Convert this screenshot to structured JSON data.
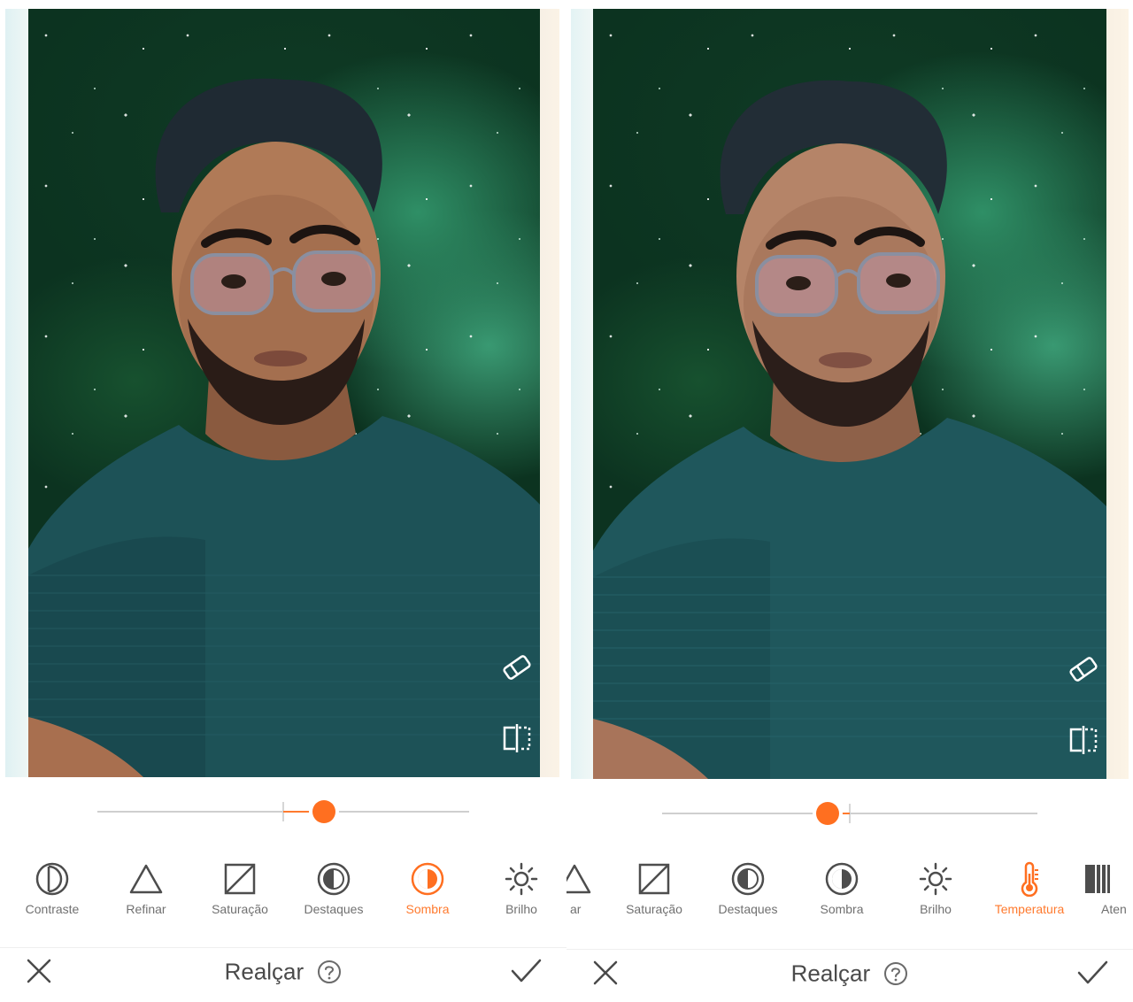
{
  "panels": [
    {
      "id": "left",
      "tools": [
        {
          "name": "contraste",
          "label": "Contraste",
          "icon": "contrast-icon",
          "active": false
        },
        {
          "name": "refinar",
          "label": "Refinar",
          "icon": "triangle-icon",
          "active": false
        },
        {
          "name": "saturacao",
          "label": "Saturação",
          "icon": "saturation-icon",
          "active": false
        },
        {
          "name": "destaques",
          "label": "Destaques",
          "icon": "highlights-icon",
          "active": false
        },
        {
          "name": "sombra",
          "label": "Sombra",
          "icon": "shadow-icon",
          "active": true
        },
        {
          "name": "brilho",
          "label": "Brilho",
          "icon": "brightness-icon",
          "active": false
        }
      ],
      "slider": {
        "min": -100,
        "max": 100,
        "value": 22
      },
      "bottom": {
        "title": "Realçar"
      }
    },
    {
      "id": "right",
      "tools": [
        {
          "name": "refinar-partial",
          "label": "ar",
          "icon": "triangle-icon",
          "active": false
        },
        {
          "name": "saturacao",
          "label": "Saturação",
          "icon": "saturation-icon",
          "active": false
        },
        {
          "name": "destaques",
          "label": "Destaques",
          "icon": "highlights-icon",
          "active": false
        },
        {
          "name": "sombra",
          "label": "Sombra",
          "icon": "shadow-icon",
          "active": false
        },
        {
          "name": "brilho",
          "label": "Brilho",
          "icon": "brightness-icon",
          "active": false
        },
        {
          "name": "temperatura",
          "label": "Temperatura",
          "icon": "thermometer-icon",
          "active": true
        },
        {
          "name": "atenuar-partial",
          "label": "Aten",
          "icon": "fade-icon",
          "active": false
        }
      ],
      "slider": {
        "min": -100,
        "max": 100,
        "value": -12
      },
      "bottom": {
        "title": "Realçar"
      }
    }
  ],
  "colors": {
    "accent": "#ff6f20",
    "text": "#707070",
    "title": "#4a4a4a"
  }
}
